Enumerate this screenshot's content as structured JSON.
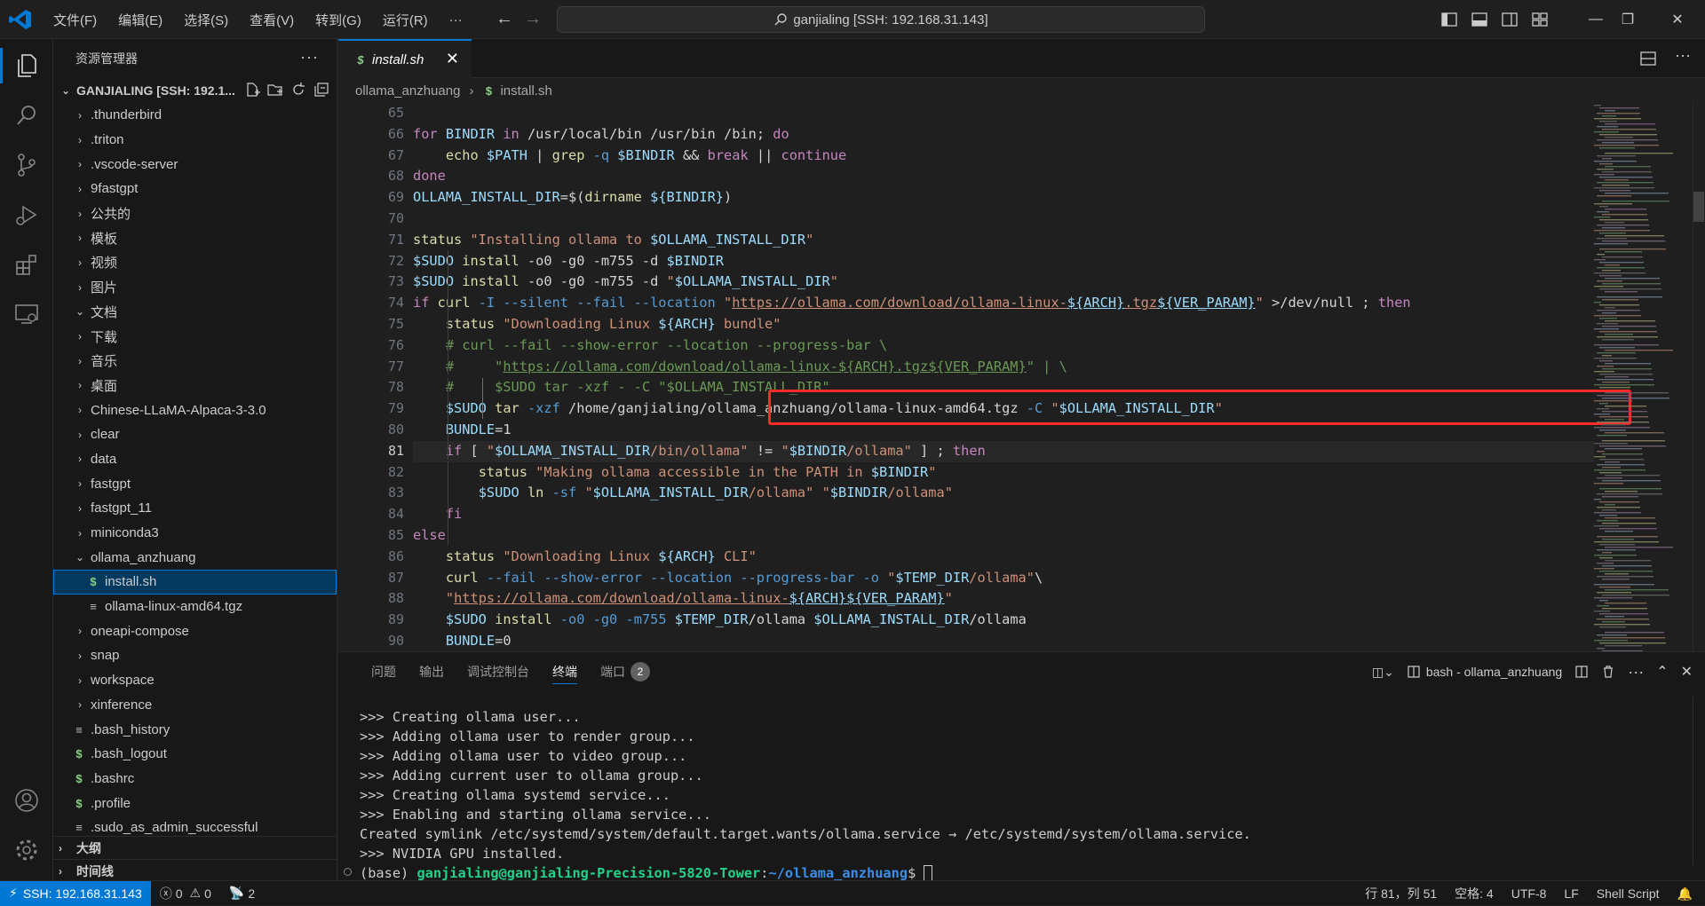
{
  "titlebar": {
    "menus": [
      "文件(F)",
      "编辑(E)",
      "选择(S)",
      "查看(V)",
      "转到(G)",
      "运行(R)",
      "···"
    ],
    "command_center": "ganjialing [SSH: 192.168.31.143]"
  },
  "sidebar": {
    "title": "资源管理器",
    "folder": "GANJIALING [SSH: 192.1...",
    "items": [
      {
        "label": ".thunderbird",
        "type": "folder",
        "open": false,
        "depth": 0
      },
      {
        "label": ".triton",
        "type": "folder",
        "open": false,
        "depth": 0
      },
      {
        "label": ".vscode-server",
        "type": "folder",
        "open": false,
        "depth": 0
      },
      {
        "label": "9fastgpt",
        "type": "folder",
        "open": false,
        "depth": 0
      },
      {
        "label": "公共的",
        "type": "folder",
        "open": false,
        "depth": 0
      },
      {
        "label": "模板",
        "type": "folder",
        "open": false,
        "depth": 0
      },
      {
        "label": "视频",
        "type": "folder",
        "open": false,
        "depth": 0
      },
      {
        "label": "图片",
        "type": "folder",
        "open": false,
        "depth": 0
      },
      {
        "label": "文档",
        "type": "folder",
        "open": true,
        "depth": 0
      },
      {
        "label": "下载",
        "type": "folder",
        "open": false,
        "depth": 0
      },
      {
        "label": "音乐",
        "type": "folder",
        "open": false,
        "depth": 0
      },
      {
        "label": "桌面",
        "type": "folder",
        "open": false,
        "depth": 0
      },
      {
        "label": "Chinese-LLaMA-Alpaca-3-3.0",
        "type": "folder",
        "open": false,
        "depth": 0
      },
      {
        "label": "clear",
        "type": "folder",
        "open": false,
        "depth": 0
      },
      {
        "label": "data",
        "type": "folder",
        "open": false,
        "depth": 0
      },
      {
        "label": "fastgpt",
        "type": "folder",
        "open": false,
        "depth": 0
      },
      {
        "label": "fastgpt_11",
        "type": "folder",
        "open": false,
        "depth": 0
      },
      {
        "label": "miniconda3",
        "type": "folder",
        "open": false,
        "depth": 0
      },
      {
        "label": "ollama_anzhuang",
        "type": "folder",
        "open": true,
        "depth": 0
      },
      {
        "label": "install.sh",
        "type": "sh",
        "depth": 1,
        "selected": true
      },
      {
        "label": "ollama-linux-amd64.tgz",
        "type": "txt",
        "depth": 1
      },
      {
        "label": "oneapi-compose",
        "type": "folder",
        "open": false,
        "depth": 0
      },
      {
        "label": "snap",
        "type": "folder",
        "open": false,
        "depth": 0
      },
      {
        "label": "workspace",
        "type": "folder",
        "open": false,
        "depth": 0
      },
      {
        "label": "xinference",
        "type": "folder",
        "open": false,
        "depth": 0
      },
      {
        "label": ".bash_history",
        "type": "txt",
        "depth": 0
      },
      {
        "label": ".bash_logout",
        "type": "sh",
        "depth": 0
      },
      {
        "label": ".bashrc",
        "type": "sh",
        "depth": 0
      },
      {
        "label": ".profile",
        "type": "sh",
        "depth": 0
      },
      {
        "label": ".sudo_as_admin_successful",
        "type": "txt",
        "depth": 0
      }
    ],
    "outline": "大纲",
    "timeline": "时间线"
  },
  "editor": {
    "tab": "install.sh",
    "breadcrumb": [
      "ollama_anzhuang",
      "install.sh"
    ],
    "lines": [
      {
        "n": "65",
        "t": []
      },
      {
        "n": "66",
        "t": [
          [
            "k",
            "for "
          ],
          [
            "v",
            "BINDIR"
          ],
          [
            "k",
            " in "
          ],
          [
            "w",
            "/usr/local/bin /usr/bin /bin"
          ],
          [
            "w",
            "; "
          ],
          [
            "k",
            "do"
          ]
        ]
      },
      {
        "n": "67",
        "t": [
          [
            "w",
            "    "
          ],
          [
            "f",
            "echo "
          ],
          [
            "v",
            "$PATH"
          ],
          [
            "w",
            " | "
          ],
          [
            "f",
            "grep"
          ],
          [
            "o",
            " -q "
          ],
          [
            "v",
            "$BINDIR"
          ],
          [
            "w",
            " && "
          ],
          [
            "k",
            "break"
          ],
          [
            "w",
            " || "
          ],
          [
            "k",
            "continue"
          ]
        ]
      },
      {
        "n": "68",
        "t": [
          [
            "k",
            "done"
          ]
        ]
      },
      {
        "n": "69",
        "t": [
          [
            "v",
            "OLLAMA_INSTALL_DIR"
          ],
          [
            "w",
            "=$("
          ],
          [
            "f",
            "dirname"
          ],
          [
            "w",
            " "
          ],
          [
            "v",
            "${BINDIR}"
          ],
          [
            "w",
            ")"
          ]
        ]
      },
      {
        "n": "70",
        "t": []
      },
      {
        "n": "71",
        "t": [
          [
            "f",
            "status "
          ],
          [
            "s",
            "\"Installing ollama to "
          ],
          [
            "v",
            "$OLLAMA_INSTALL_DIR"
          ],
          [
            "s",
            "\""
          ]
        ]
      },
      {
        "n": "72",
        "t": [
          [
            "v",
            "$SUDO"
          ],
          [
            "f",
            " install"
          ],
          [
            "w",
            " -o0 -g0 -m755 -d "
          ],
          [
            "v",
            "$BINDIR"
          ]
        ]
      },
      {
        "n": "73",
        "t": [
          [
            "v",
            "$SUDO"
          ],
          [
            "f",
            " install"
          ],
          [
            "w",
            " -o0 -g0 -m755 -d "
          ],
          [
            "s",
            "\""
          ],
          [
            "v",
            "$OLLAMA_INSTALL_DIR"
          ],
          [
            "s",
            "\""
          ]
        ]
      },
      {
        "n": "74",
        "t": [
          [
            "k",
            "if "
          ],
          [
            "f",
            "curl"
          ],
          [
            "o",
            " -I --silent --fail --location "
          ],
          [
            "s",
            "\""
          ],
          [
            "su",
            "https://ollama.com/download/ollama-linux-"
          ],
          [
            "vu",
            "${ARCH}"
          ],
          [
            "su",
            ".tgz"
          ],
          [
            "vu",
            "${VER_PARAM}"
          ],
          [
            "s",
            "\""
          ],
          [
            "w",
            " >/dev/null ; "
          ],
          [
            "k",
            "then"
          ]
        ]
      },
      {
        "n": "75",
        "t": [
          [
            "w",
            "    "
          ],
          [
            "f",
            "status "
          ],
          [
            "s",
            "\"Downloading Linux "
          ],
          [
            "v",
            "${ARCH}"
          ],
          [
            "s",
            " bundle\""
          ]
        ]
      },
      {
        "n": "76",
        "t": [
          [
            "w",
            "    "
          ],
          [
            "c",
            "# curl --fail --show-error --location --progress-bar \\"
          ]
        ]
      },
      {
        "n": "77",
        "t": [
          [
            "w",
            "    "
          ],
          [
            "c",
            "#     \""
          ],
          [
            "cu",
            "https://ollama.com/download/ollama-linux-${ARCH}.tgz${VER_PARAM}"
          ],
          [
            "c",
            "\" | \\"
          ]
        ]
      },
      {
        "n": "78",
        "t": [
          [
            "w",
            "    "
          ],
          [
            "c",
            "#     $SUDO tar -xzf - -C \"$OLLAMA_INSTALL_DIR\""
          ]
        ]
      },
      {
        "n": "79",
        "t": [
          [
            "w",
            "    "
          ],
          [
            "v",
            "$SUDO"
          ],
          [
            "f",
            " tar"
          ],
          [
            "o",
            " -xzf "
          ],
          [
            "w",
            "/home/ganjialing/ollama_anzhuang/ollama-linux-amd64.tgz"
          ],
          [
            "o",
            " -C "
          ],
          [
            "s",
            "\""
          ],
          [
            "v",
            "$OLLAMA_INSTALL_DIR"
          ],
          [
            "s",
            "\""
          ]
        ]
      },
      {
        "n": "80",
        "t": [
          [
            "w",
            "    "
          ],
          [
            "v",
            "BUNDLE"
          ],
          [
            "w",
            "="
          ],
          [
            "w",
            "1"
          ]
        ]
      },
      {
        "n": "81",
        "t": [
          [
            "w",
            "    "
          ],
          [
            "k",
            "if "
          ],
          [
            "w",
            "[ "
          ],
          [
            "s",
            "\""
          ],
          [
            "v",
            "$OLLAMA_INSTALL_DIR"
          ],
          [
            "s",
            "/bin/ollama\""
          ],
          [
            "w",
            " != "
          ],
          [
            "s",
            "\""
          ],
          [
            "v",
            "$BINDIR"
          ],
          [
            "s",
            "/ollama\""
          ],
          [
            "w",
            " ] ; "
          ],
          [
            "k",
            "then"
          ]
        ]
      },
      {
        "n": "82",
        "t": [
          [
            "w",
            "        "
          ],
          [
            "f",
            "status "
          ],
          [
            "s",
            "\"Making ollama accessible in the PATH in "
          ],
          [
            "v",
            "$BINDIR"
          ],
          [
            "s",
            "\""
          ]
        ]
      },
      {
        "n": "83",
        "t": [
          [
            "w",
            "        "
          ],
          [
            "v",
            "$SUDO"
          ],
          [
            "f",
            " ln"
          ],
          [
            "o",
            " -sf "
          ],
          [
            "s",
            "\""
          ],
          [
            "v",
            "$OLLAMA_INSTALL_DIR"
          ],
          [
            "s",
            "/ollama\""
          ],
          [
            "w",
            " "
          ],
          [
            "s",
            "\""
          ],
          [
            "v",
            "$BINDIR"
          ],
          [
            "s",
            "/ollama\""
          ]
        ]
      },
      {
        "n": "84",
        "t": [
          [
            "w",
            "    "
          ],
          [
            "k",
            "fi"
          ]
        ]
      },
      {
        "n": "85",
        "t": [
          [
            "k",
            "else"
          ]
        ]
      },
      {
        "n": "86",
        "t": [
          [
            "w",
            "    "
          ],
          [
            "f",
            "status "
          ],
          [
            "s",
            "\"Downloading Linux "
          ],
          [
            "v",
            "${ARCH}"
          ],
          [
            "s",
            " CLI\""
          ]
        ]
      },
      {
        "n": "87",
        "t": [
          [
            "w",
            "    "
          ],
          [
            "f",
            "curl"
          ],
          [
            "o",
            " --fail --show-error --location --progress-bar -o "
          ],
          [
            "s",
            "\""
          ],
          [
            "v",
            "$TEMP_DIR"
          ],
          [
            "s",
            "/ollama\""
          ],
          [
            "w",
            "\\"
          ]
        ]
      },
      {
        "n": "88",
        "t": [
          [
            "w",
            "    "
          ],
          [
            "s",
            "\""
          ],
          [
            "su",
            "https://ollama.com/download/ollama-linux-"
          ],
          [
            "vu",
            "${ARCH}"
          ],
          [
            "vu",
            "${VER_PARAM}"
          ],
          [
            "s",
            "\""
          ]
        ]
      },
      {
        "n": "89",
        "t": [
          [
            "w",
            "    "
          ],
          [
            "v",
            "$SUDO"
          ],
          [
            "f",
            " install"
          ],
          [
            "o",
            " -o0 -g0 -m755 "
          ],
          [
            "v",
            "$TEMP_DIR"
          ],
          [
            "w",
            "/ollama "
          ],
          [
            "v",
            "$OLLAMA_INSTALL_DIR"
          ],
          [
            "w",
            "/ollama"
          ]
        ]
      },
      {
        "n": "90",
        "t": [
          [
            "w",
            "    "
          ],
          [
            "v",
            "BUNDLE"
          ],
          [
            "w",
            "=0"
          ]
        ]
      }
    ]
  },
  "panel": {
    "tabs": [
      "问题",
      "输出",
      "调试控制台",
      "终端",
      "端口"
    ],
    "active": "终端",
    "ports_badge": "2",
    "terminal_name": "bash - ollama_anzhuang",
    "lines": [
      ">>> Creating ollama user...",
      ">>> Adding ollama user to render group...",
      ">>> Adding ollama user to video group...",
      ">>> Adding current user to ollama group...",
      ">>> Creating ollama systemd service...",
      ">>> Enabling and starting ollama service...",
      "Created symlink /etc/systemd/system/default.target.wants/ollama.service → /etc/systemd/system/ollama.service.",
      ">>> NVIDIA GPU installed."
    ],
    "prompt": {
      "env": "(base) ",
      "user": "ganjialing@ganjialing-Precision-5820-Tower",
      "sep": ":",
      "path": "~/ollama_anzhuang",
      "end": "$ "
    }
  },
  "statusbar": {
    "remote": "SSH: 192.168.31.143",
    "errors": "0",
    "warnings": "0",
    "ports": "2",
    "position": "行 81，列 51",
    "spaces": "空格: 4",
    "encoding": "UTF-8",
    "eol": "LF",
    "language": "Shell Script"
  },
  "colors": {
    "accent": "#0078d4",
    "highlight_box": "#ff2a2a"
  }
}
